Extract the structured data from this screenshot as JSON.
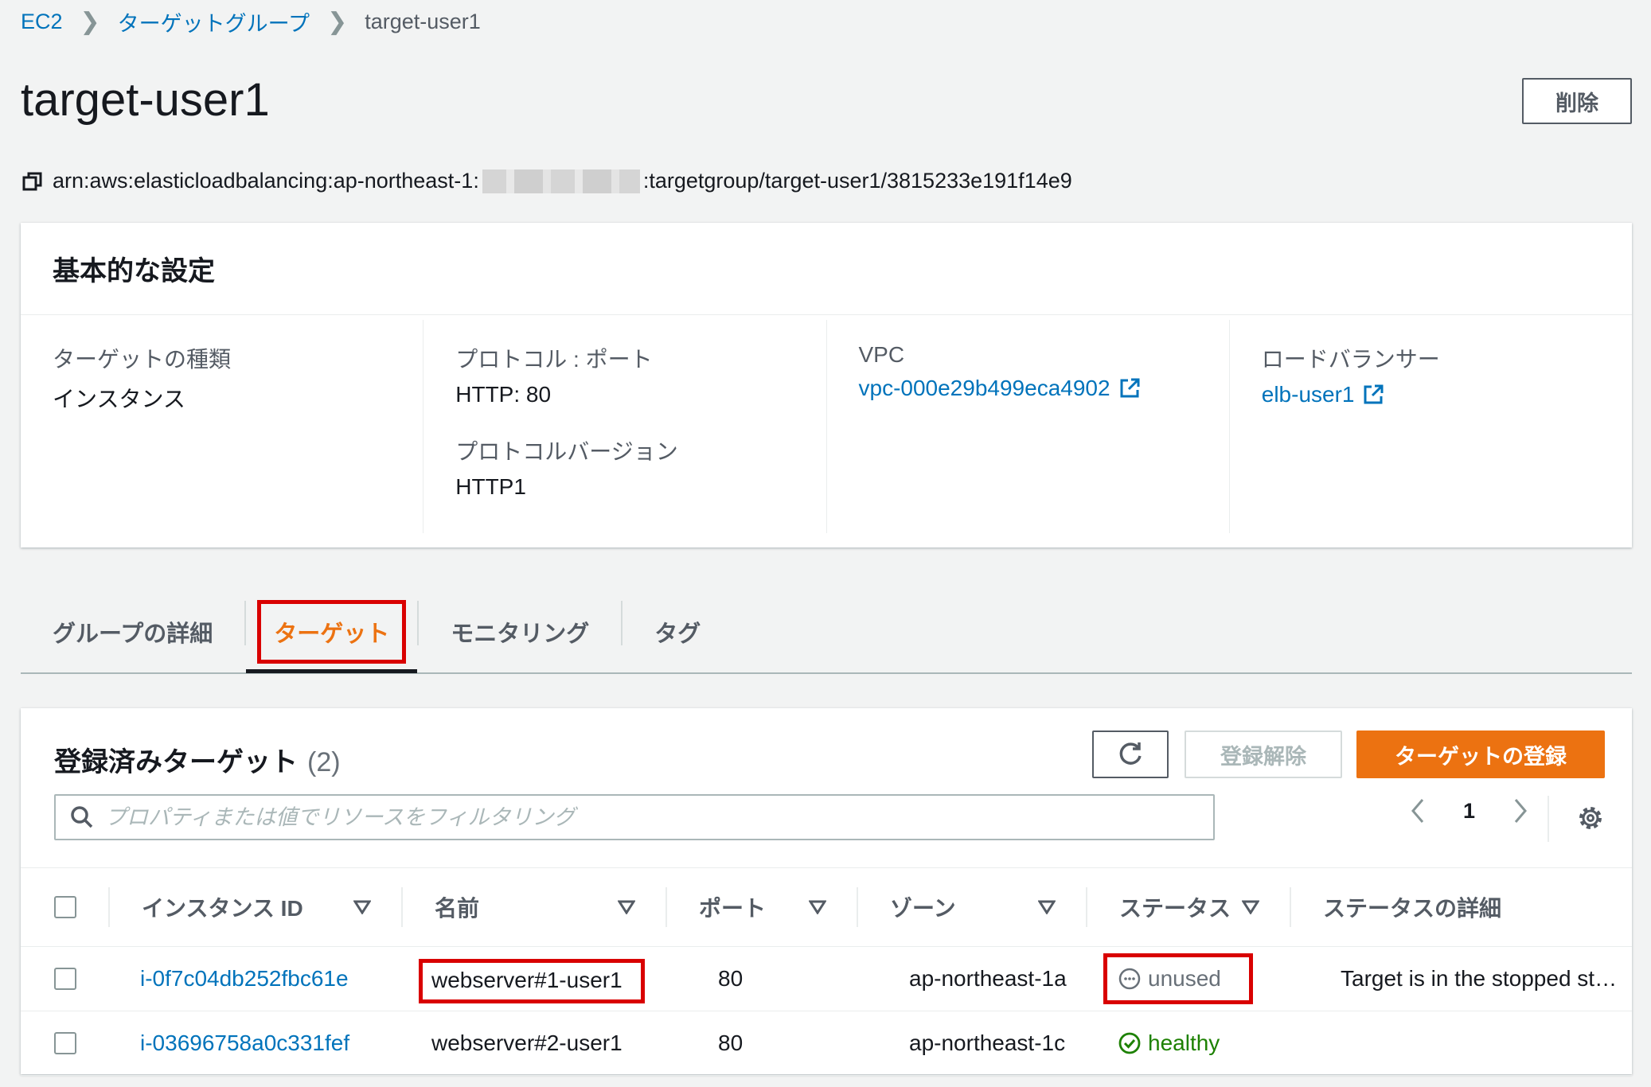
{
  "breadcrumb": {
    "items": [
      "EC2",
      "ターゲットグループ"
    ],
    "current": "target-user1"
  },
  "page": {
    "title": "target-user1",
    "delete_label": "削除",
    "arn_prefix": "arn:aws:elasticloadbalancing:ap-northeast-1:",
    "arn_suffix": ":targetgroup/target-user1/3815233e191f14e9"
  },
  "settings": {
    "header": "基本的な設定",
    "target_type_label": "ターゲットの種類",
    "target_type_value": "インスタンス",
    "protocol_port_label": "プロトコル : ポート",
    "protocol_port_value": "HTTP: 80",
    "protocol_version_label": "プロトコルバージョン",
    "protocol_version_value": "HTTP1",
    "vpc_label": "VPC",
    "vpc_value": "vpc-000e29b499eca4902",
    "lb_label": "ロードバランサー",
    "lb_value": "elb-user1"
  },
  "tabs": [
    {
      "label": "グループの詳細"
    },
    {
      "label": "ターゲット"
    },
    {
      "label": "モニタリング"
    },
    {
      "label": "タグ"
    }
  ],
  "targets": {
    "title": "登録済みターゲット",
    "count": "(2)",
    "deregister_label": "登録解除",
    "register_label": "ターゲットの登録",
    "search_placeholder": "プロパティまたは値でリソースをフィルタリング",
    "page_number": "1",
    "columns": [
      "インスタンス ID",
      "名前",
      "ポート",
      "ゾーン",
      "ステータス",
      "ステータスの詳細"
    ],
    "rows": [
      {
        "instance_id": "i-0f7c04db252fbc61e",
        "name": "webserver#1-user1",
        "port": "80",
        "zone": "ap-northeast-1a",
        "status": "unused",
        "status_detail": "Target is in the stopped st…"
      },
      {
        "instance_id": "i-03696758a0c331fef",
        "name": "webserver#2-user1",
        "port": "80",
        "zone": "ap-northeast-1c",
        "status": "healthy",
        "status_detail": ""
      }
    ]
  },
  "colors": {
    "link": "#0073bb",
    "accent_orange": "#ec7211",
    "highlight_red": "#d90000",
    "healthy_green": "#1d8102"
  }
}
